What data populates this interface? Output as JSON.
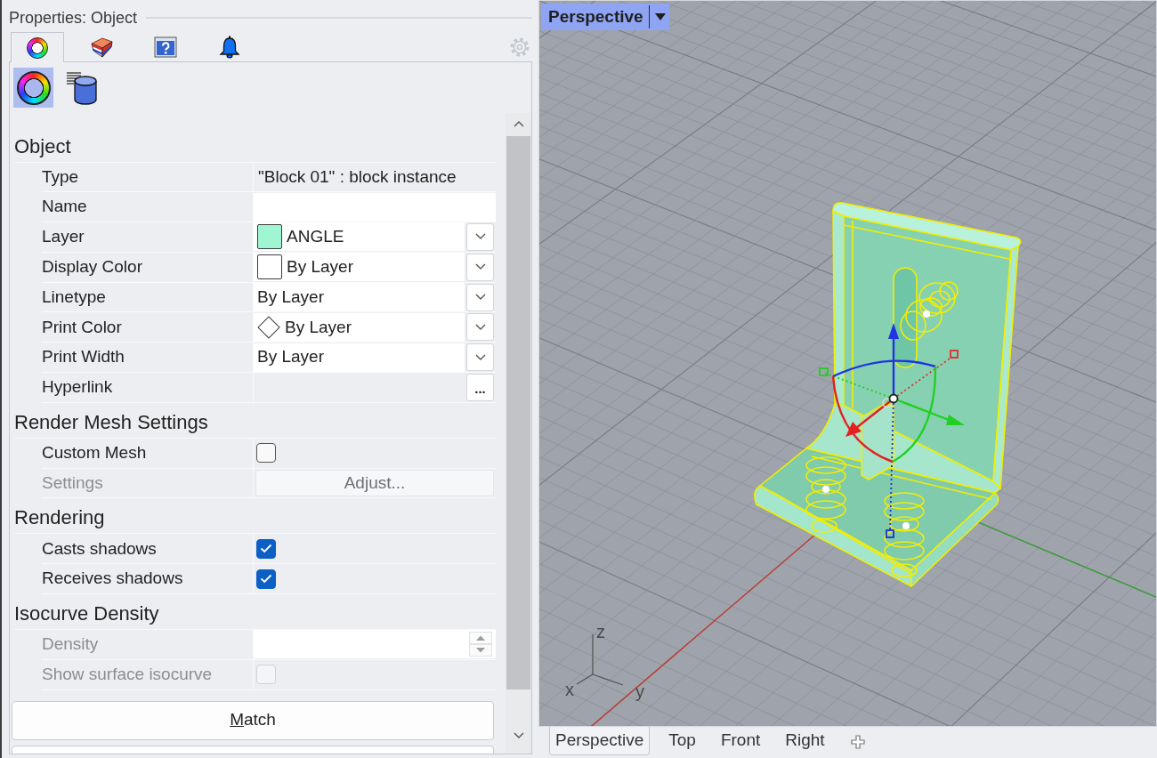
{
  "properties_panel": {
    "title": "Properties: Object",
    "tabs": [
      {
        "kind": "color-wheel",
        "selected": true
      },
      {
        "kind": "material",
        "selected": false
      },
      {
        "kind": "help",
        "selected": false
      },
      {
        "kind": "bell",
        "selected": false
      }
    ],
    "sub_tabs": [
      {
        "kind": "color-wheel",
        "selected": true
      },
      {
        "kind": "database",
        "selected": false
      }
    ],
    "sections": [
      {
        "title": "Object",
        "rows": [
          {
            "label": "Type",
            "kind": "text",
            "value": "\"Block 01\" : block instance",
            "disabled": false
          },
          {
            "label": "Name",
            "kind": "input",
            "disabled": false
          },
          {
            "label": "Layer",
            "kind": "dropdown",
            "value": "ANGLE",
            "swatch": {
              "kind": "square",
              "color": "#a0f5d2"
            },
            "disabled": false
          },
          {
            "label": "Display Color",
            "kind": "dropdown",
            "value": "By Layer",
            "swatch": {
              "kind": "square",
              "color": "#ffffff"
            },
            "disabled": false
          },
          {
            "label": "Linetype",
            "kind": "dropdown",
            "value": "By Layer",
            "disabled": false
          },
          {
            "label": "Print Color",
            "kind": "dropdown",
            "value": "By Layer",
            "swatch": {
              "kind": "diamond",
              "color": "#ffffff"
            },
            "disabled": false
          },
          {
            "label": "Print Width",
            "kind": "dropdown",
            "value": "By Layer",
            "disabled": false
          },
          {
            "label": "Hyperlink",
            "kind": "browse",
            "button": "...",
            "disabled": false
          }
        ]
      },
      {
        "title": "Render Mesh Settings",
        "rows": [
          {
            "label": "Custom Mesh",
            "kind": "checkbox",
            "checked": false,
            "disabled": false
          },
          {
            "label": "Settings",
            "kind": "button",
            "button": "Adjust...",
            "disabled": true
          }
        ]
      },
      {
        "title": "Rendering",
        "rows": [
          {
            "label": "Casts shadows",
            "kind": "checkbox",
            "checked": true,
            "disabled": false
          },
          {
            "label": "Receives shadows",
            "kind": "checkbox",
            "checked": true,
            "disabled": false
          }
        ]
      },
      {
        "title": "Isocurve Density",
        "rows": [
          {
            "label": "Density",
            "kind": "spinner",
            "disabled": true
          },
          {
            "label": "Show surface isocurve",
            "kind": "checkbox",
            "checked": false,
            "disabled": true
          }
        ]
      }
    ],
    "buttons": [
      {
        "kind": "full",
        "label": "Match",
        "mnemonic": true
      },
      {
        "kind": "cut-off"
      }
    ]
  },
  "viewport": {
    "title": "Perspective",
    "axis_labels": {
      "z": "z",
      "x": "x",
      "y": "y"
    },
    "tabs": [
      {
        "label": "Perspective",
        "selected": true
      },
      {
        "label": "Top",
        "selected": false
      },
      {
        "label": "Front",
        "selected": false
      },
      {
        "label": "Right",
        "selected": false
      }
    ]
  }
}
